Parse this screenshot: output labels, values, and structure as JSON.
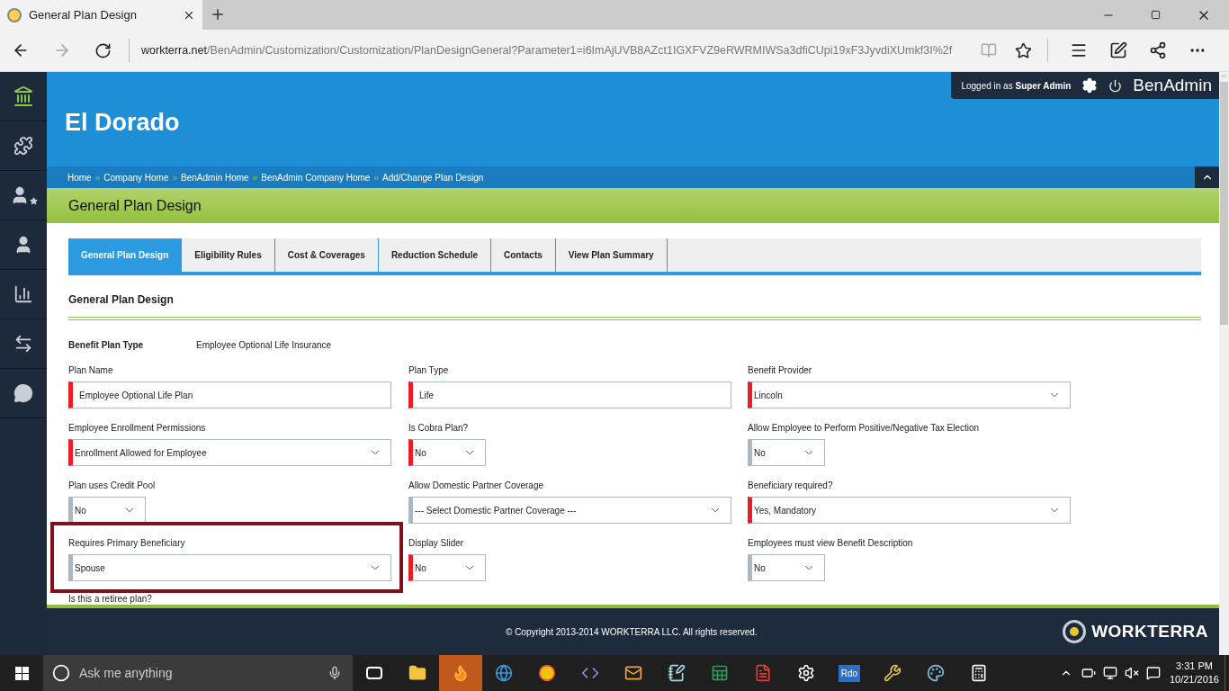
{
  "browser": {
    "tab_title": "General Plan Design",
    "url_domain": "workterra.net",
    "url_path": "/BenAdmin/Customization/Customization/PlanDesignGeneral?Parameter1=i6ImAjUVB8AZct1IGXFVZ9eRWRMIWSa3dfiCUpi19xF3JyvdiXUmkf3I%2f"
  },
  "sidebar": {
    "items": [
      {
        "kind": "home",
        "selected": true
      },
      {
        "kind": "puzzle",
        "selected": false
      },
      {
        "kind": "user-star",
        "selected": false
      },
      {
        "kind": "user",
        "selected": false
      },
      {
        "kind": "chart",
        "selected": false
      },
      {
        "kind": "swap",
        "selected": false
      },
      {
        "kind": "chat",
        "selected": false
      }
    ]
  },
  "header": {
    "company": "El Dorado",
    "login": "Logged in as **Super Admin**",
    "app_name": "BenAdmin"
  },
  "breadcrumbs": [
    {
      "label": "Home"
    },
    {
      "separator": "»",
      "label": "Company Home"
    },
    {
      "separator": "»",
      "label": "BenAdmin Home"
    },
    {
      "separator": "»",
      "label": "BenAdmin Company Home"
    },
    {
      "separator": "»",
      "label": "Add/Change Plan Design"
    }
  ],
  "page_title": "General Plan Design",
  "tabs": [
    {
      "label": "General Plan Design",
      "selected": true
    },
    {
      "label": "Eligibility Rules",
      "selected": false
    },
    {
      "label": "Cost & Coverages",
      "selected": false
    },
    {
      "label": "Reduction Schedule",
      "selected": false
    },
    {
      "label": "Contacts",
      "selected": false
    },
    {
      "label": "View Plan Summary",
      "selected": false
    }
  ],
  "section_title": "General Plan Design",
  "benefit_plan_type": {
    "label": "Benefit Plan Type",
    "value": "Employee Optional Life Insurance"
  },
  "fields": [
    {
      "label": "Plan Name",
      "kind": "text",
      "value": "Employee Optional Life Plan",
      "required": true,
      "highlighted": false
    },
    {
      "label": "Plan Type",
      "kind": "text",
      "value": "Life",
      "required": true,
      "highlighted": false
    },
    {
      "label": "Benefit Provider",
      "kind": "select",
      "value": "Lincoln",
      "required": true,
      "highlighted": false
    },
    {
      "label": "Employee Enrollment Permissions",
      "kind": "select",
      "value": "Enrollment Allowed for Employee",
      "required": true,
      "highlighted": false
    },
    {
      "label": "Is Cobra Plan?",
      "kind": "toggle",
      "value": "No",
      "required": true,
      "highlighted": false
    },
    {
      "label": "Allow Employee to Perform Positive/Negative Tax Election",
      "kind": "toggle",
      "value": "No",
      "required": false,
      "highlighted": false
    },
    {
      "label": "Plan uses Credit Pool",
      "kind": "toggle",
      "value": "No",
      "required": false,
      "highlighted": false
    },
    {
      "label": "Allow Domestic Partner Coverage",
      "kind": "select",
      "value": "--- Select Domestic Partner Coverage ---",
      "required": false,
      "highlighted": false
    },
    {
      "label": "Beneficiary required?",
      "kind": "select",
      "value": "Yes, Mandatory",
      "required": true,
      "highlighted": false
    },
    {
      "label": "Requires Primary Beneficiary",
      "kind": "select",
      "value": "Spouse",
      "required": false,
      "highlighted": true
    },
    {
      "label": "Display Slider",
      "kind": "toggle",
      "value": "No",
      "required": true,
      "highlighted": false
    },
    {
      "label": "Employees must view Benefit Description",
      "kind": "toggle",
      "value": "No",
      "required": false,
      "highlighted": false
    }
  ],
  "cut_label": "Is this a retiree plan?",
  "footer": {
    "copyright": "© Copyright 2013-2014 WORKTERRA LLC. All rights reserved.",
    "logo_text": "WORKTERRA"
  },
  "taskbar": {
    "search_placeholder": "Ask me anything",
    "apps": [
      {
        "kind": "folder",
        "selected": false
      },
      {
        "kind": "flame",
        "selected": true
      },
      {
        "kind": "edge",
        "selected": false
      },
      {
        "kind": "chrome",
        "selected": false
      },
      {
        "kind": "code",
        "selected": false
      },
      {
        "kind": "mail",
        "selected": false
      },
      {
        "kind": "note",
        "selected": false
      },
      {
        "kind": "sheet",
        "selected": false
      },
      {
        "kind": "pdf",
        "selected": false
      },
      {
        "kind": "gear",
        "selected": false
      },
      {
        "kind": "rdo",
        "label": "Rdo",
        "selected": false
      },
      {
        "kind": "tools",
        "selected": false
      },
      {
        "kind": "palette",
        "selected": false
      },
      {
        "kind": "calculator",
        "selected": false
      }
    ],
    "time": "3:31 PM",
    "date": "10/21/2016"
  }
}
